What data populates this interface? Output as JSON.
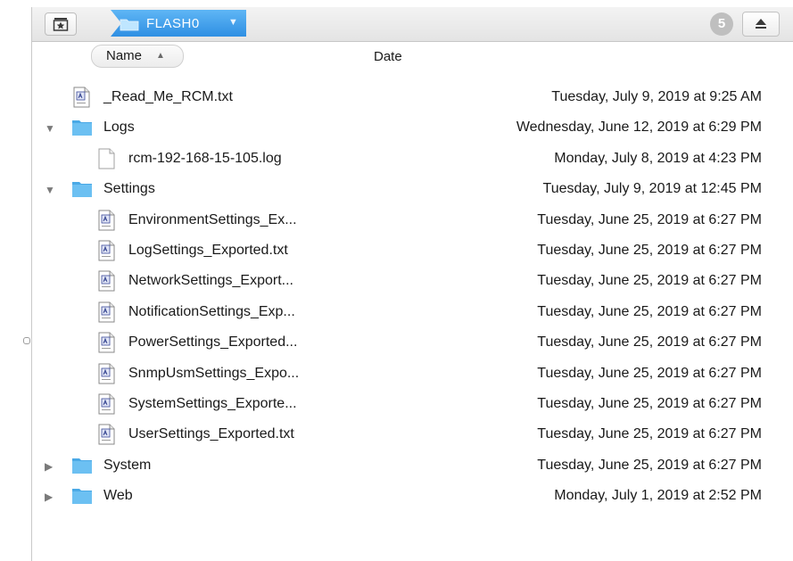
{
  "toolbar": {
    "breadcrumb_label": "FLASH0",
    "badge_count": "5"
  },
  "columns": {
    "name_label": "Name",
    "date_label": "Date"
  },
  "rows": [
    {
      "name": "_Read_Me_RCM.txt",
      "date": "Tuesday, July 9, 2019 at 9:25 AM",
      "kind": "text-file",
      "level": 0
    },
    {
      "name": "Logs",
      "date": "Wednesday, June 12, 2019 at 6:29 PM",
      "kind": "folder",
      "level": 0,
      "disclosure": "expanded"
    },
    {
      "name": "rcm-192-168-15-105.log",
      "date": "Monday, July 8, 2019 at 4:23 PM",
      "kind": "blank-file",
      "level": 1
    },
    {
      "name": "Settings",
      "date": "Tuesday, July 9, 2019 at 12:45 PM",
      "kind": "folder",
      "level": 0,
      "disclosure": "expanded"
    },
    {
      "name": "EnvironmentSettings_Ex...",
      "date": "Tuesday, June 25, 2019 at 6:27 PM",
      "kind": "text-file",
      "level": 1
    },
    {
      "name": "LogSettings_Exported.txt",
      "date": "Tuesday, June 25, 2019 at 6:27 PM",
      "kind": "text-file",
      "level": 1
    },
    {
      "name": "NetworkSettings_Export...",
      "date": "Tuesday, June 25, 2019 at 6:27 PM",
      "kind": "text-file",
      "level": 1
    },
    {
      "name": "NotificationSettings_Exp...",
      "date": "Tuesday, June 25, 2019 at 6:27 PM",
      "kind": "text-file",
      "level": 1
    },
    {
      "name": "PowerSettings_Exported...",
      "date": "Tuesday, June 25, 2019 at 6:27 PM",
      "kind": "text-file",
      "level": 1
    },
    {
      "name": "SnmpUsmSettings_Expo...",
      "date": "Tuesday, June 25, 2019 at 6:27 PM",
      "kind": "text-file",
      "level": 1
    },
    {
      "name": "SystemSettings_Exporte...",
      "date": "Tuesday, June 25, 2019 at 6:27 PM",
      "kind": "text-file",
      "level": 1
    },
    {
      "name": "UserSettings_Exported.txt",
      "date": "Tuesday, June 25, 2019 at 6:27 PM",
      "kind": "text-file",
      "level": 1
    },
    {
      "name": "System",
      "date": "Tuesday, June 25, 2019 at 6:27 PM",
      "kind": "folder",
      "level": 0,
      "disclosure": "collapsed"
    },
    {
      "name": "Web",
      "date": "Monday, July 1, 2019 at 2:52 PM",
      "kind": "folder",
      "level": 0,
      "disclosure": "collapsed"
    }
  ],
  "colors": {
    "accent": "#2f8fe3",
    "folder": "#5bb8ee",
    "badge": "#bfbfbf"
  }
}
